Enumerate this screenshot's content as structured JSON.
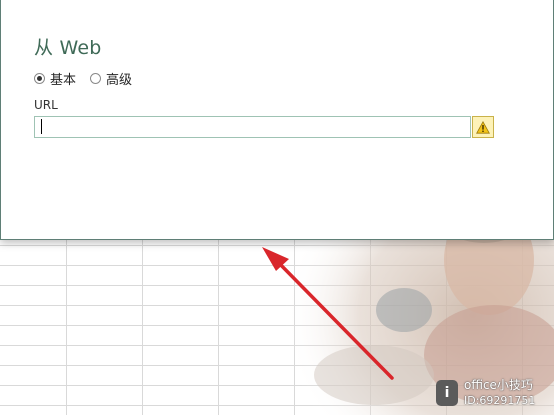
{
  "dialog": {
    "title": "从 Web",
    "radio_basic": "基本",
    "radio_advanced": "高级",
    "selected_mode": "基本",
    "url_label": "URL",
    "url_value": "",
    "warn_icon": "warning-icon"
  },
  "watermark": {
    "name": "office小技巧",
    "id": "ID:69291751"
  },
  "colors": {
    "title": "#3f6a57",
    "input_border": "#9fc3b4",
    "warn_bg": "#fdf2b8",
    "arrow": "#d9262b"
  }
}
